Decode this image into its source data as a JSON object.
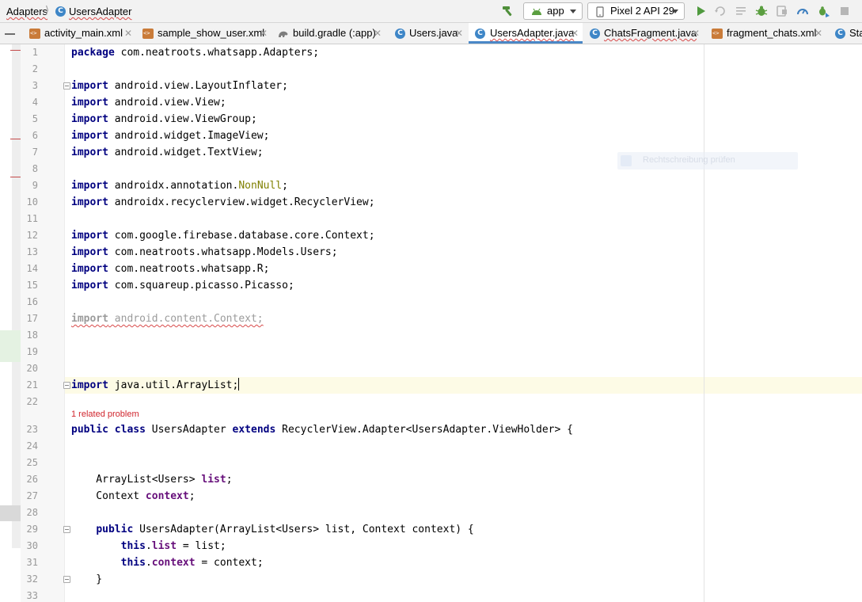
{
  "navbar": {
    "breadcrumb": [
      "Adapters",
      "UsersAdapter"
    ],
    "run_config": "app",
    "device": "Pixel 2 API 29"
  },
  "icons": {
    "class_icon_letter": "C",
    "tab_close": "✕"
  },
  "tabs": [
    {
      "label": "activity_main.xml",
      "icon": "xml-file-icon",
      "active": false
    },
    {
      "label": "sample_show_user.xml",
      "icon": "xml-file-icon",
      "active": false
    },
    {
      "label": "build.gradle (:app)",
      "icon": "gradle-icon",
      "active": false
    },
    {
      "label": "Users.java",
      "icon": "java-class-icon",
      "active": false
    },
    {
      "label": "UsersAdapter.java",
      "icon": "java-class-icon",
      "active": true
    },
    {
      "label": "ChatsFragment.java",
      "icon": "java-class-icon",
      "active": false
    },
    {
      "label": "fragment_chats.xml",
      "icon": "xml-file-icon",
      "active": false
    },
    {
      "label": "Sta",
      "icon": "java-class-icon",
      "active": false
    }
  ],
  "editor": {
    "line_numbers": [
      "1",
      "2",
      "3",
      "4",
      "5",
      "6",
      "7",
      "8",
      "9",
      "10",
      "11",
      "12",
      "13",
      "14",
      "15",
      "16",
      "17",
      "18",
      "19",
      "20",
      "21",
      "22",
      "23",
      "24",
      "25",
      "26",
      "27",
      "28",
      "29",
      "30",
      "31",
      "32",
      "33"
    ],
    "code": {
      "l1_kw": "package",
      "l1_rest": " com.neatroots.whatsapp.Adapters;",
      "import_kw": "import",
      "l3": " android.view.LayoutInflater;",
      "l4": " android.view.View;",
      "l5": " android.view.ViewGroup;",
      "l6": " android.widget.ImageView;",
      "l7": " android.widget.TextView;",
      "l9_pre": " androidx.annotation.",
      "l9_ann": "NonNull",
      "l9_post": ";",
      "l10": " androidx.recyclerview.widget.RecyclerView;",
      "l12": " com.google.firebase.database.core.Context;",
      "l13": " com.neatroots.whatsapp.Models.Users;",
      "l14": " com.neatroots.whatsapp.R;",
      "l15": " com.squareup.picasso.Picasso;",
      "l17": " android.content.Context;",
      "l21": " java.util.ArrayList;",
      "l23_public": "public",
      "l23_class": "class",
      "l23_name": " UsersAdapter ",
      "l23_extends": "extends",
      "l23_rest": " RecyclerView.Adapter<UsersAdapter.ViewHolder> {",
      "l26_type": "    ArrayList<Users> ",
      "l26_field": "list",
      "l26_end": ";",
      "l27_type": "    Context ",
      "l27_field": "context",
      "l27_end": ";",
      "l29_indent": "    ",
      "l29_public": "public",
      "l29_rest": " UsersAdapter(ArrayList<Users> list, Context context) {",
      "this_kw": "this",
      "l30_indent": "        ",
      "l30_dot": ".",
      "l30_field": "list",
      "l30_rest": " = list;",
      "l31_indent": "        ",
      "l31_dot": ".",
      "l31_field": "context",
      "l31_rest": " = context;",
      "l32": "    }"
    },
    "problem_hint": "1 related problem",
    "popup_text": "Rechtschreibung prüfen"
  }
}
